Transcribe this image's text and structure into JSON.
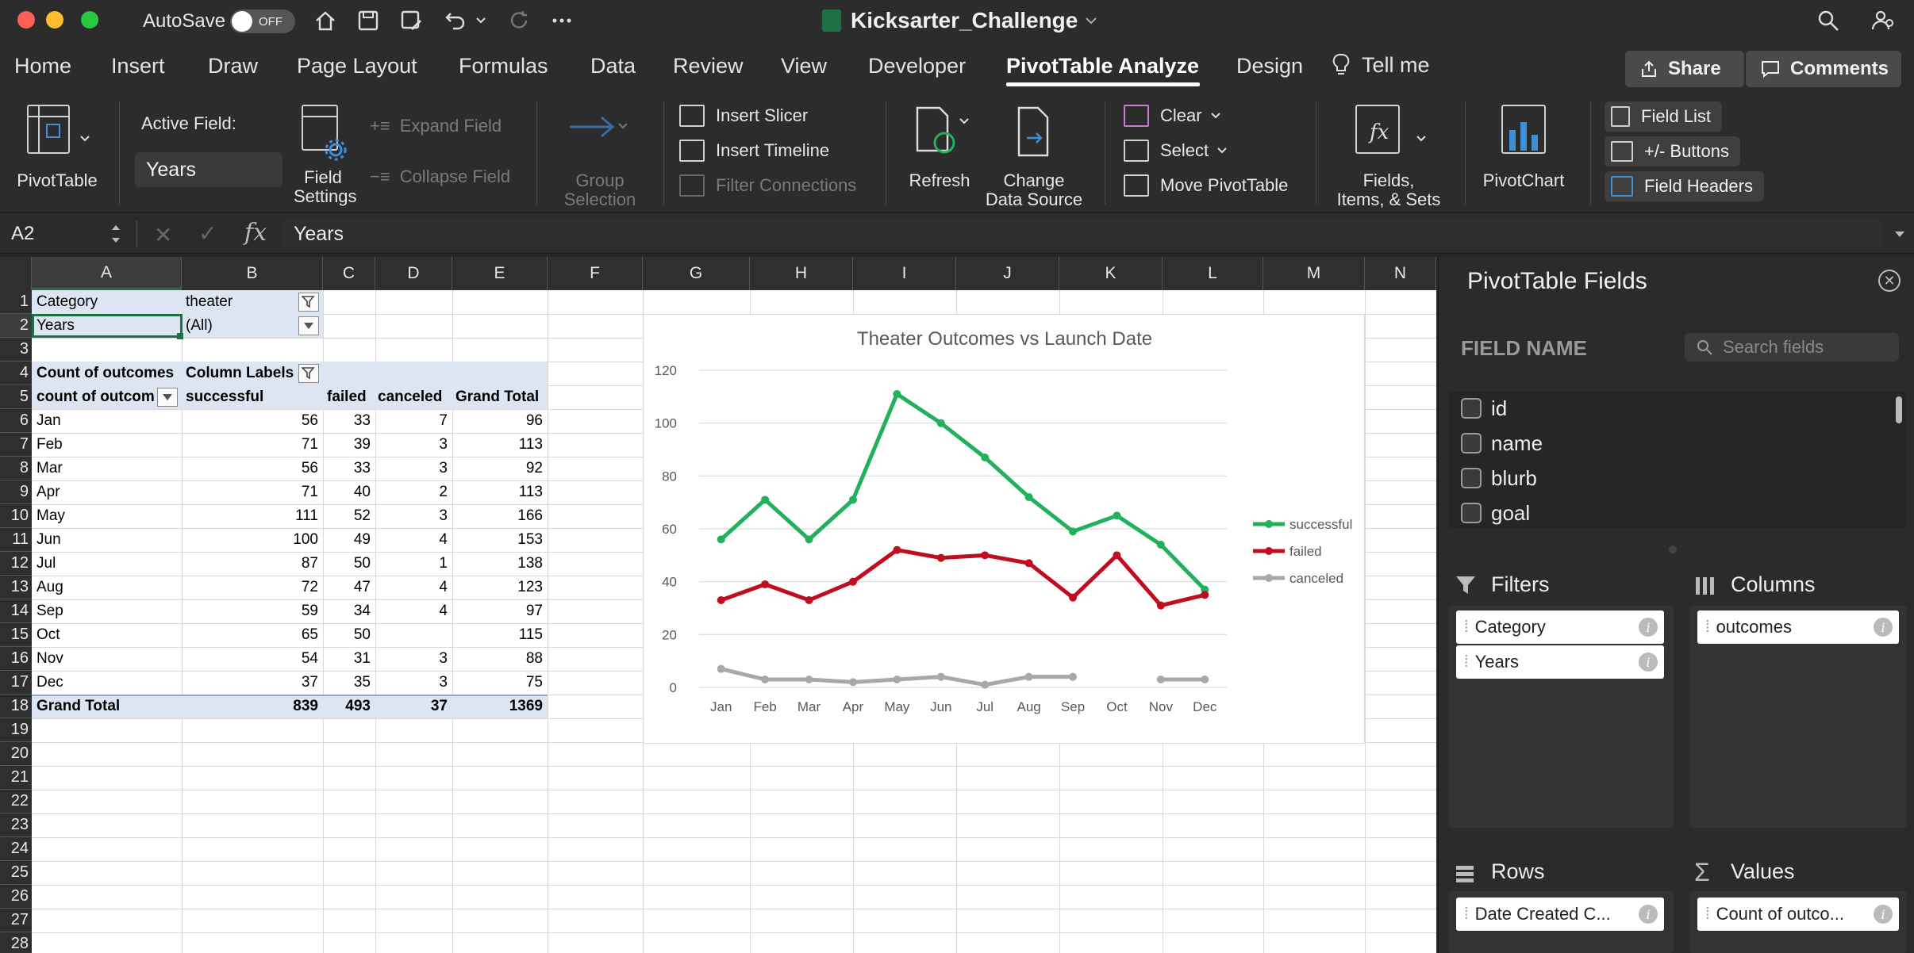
{
  "titlebar": {
    "autosave_label": "AutoSave",
    "autosave_state": "OFF",
    "document_title": "Kicksarter_Challenge",
    "icons": [
      "home-icon",
      "save-icon",
      "save-as-icon",
      "undo-icon",
      "redo-icon",
      "more-icon",
      "search-icon",
      "account-icon"
    ]
  },
  "menu": {
    "tabs": [
      "Home",
      "Insert",
      "Draw",
      "Page Layout",
      "Formulas",
      "Data",
      "Review",
      "View",
      "Developer",
      "PivotTable Analyze",
      "Design"
    ],
    "active_tab": "PivotTable Analyze",
    "tell_me": "Tell me",
    "share": "Share",
    "comments": "Comments"
  },
  "ribbon": {
    "pivottable": "PivotTable",
    "active_field_label": "Active Field:",
    "active_field_value": "Years",
    "field_settings": [
      "Field",
      "Settings"
    ],
    "expand_field": "Expand Field",
    "collapse_field": "Collapse Field",
    "group_selection": [
      "Group",
      "Selection"
    ],
    "insert_slicer": "Insert Slicer",
    "insert_timeline": "Insert Timeline",
    "filter_connections": "Filter Connections",
    "refresh": "Refresh",
    "change_data_source": [
      "Change",
      "Data Source"
    ],
    "clear": "Clear",
    "select": "Select",
    "move_pivottable": "Move PivotTable",
    "fields_items_sets": [
      "Fields,",
      "Items, & Sets"
    ],
    "pivotchart": "PivotChart",
    "field_list": "Field List",
    "plus_minus_buttons": "+/- Buttons",
    "field_headers": "Field Headers"
  },
  "formula_bar": {
    "name_box": "A2",
    "fx": "fx",
    "content": "Years"
  },
  "sheet": {
    "columns": [
      "A",
      "B",
      "C",
      "D",
      "E",
      "F",
      "G",
      "H",
      "I",
      "J",
      "K",
      "L",
      "M",
      "N"
    ],
    "rows": [
      "1",
      "2",
      "3",
      "4",
      "5",
      "6",
      "7",
      "8",
      "9",
      "10",
      "11",
      "12",
      "13",
      "14",
      "15",
      "16",
      "17",
      "18",
      "19",
      "20",
      "21",
      "22",
      "23",
      "24",
      "25",
      "26",
      "27",
      "28"
    ],
    "filter": {
      "row1": [
        "Category",
        "theater"
      ],
      "row2": [
        "Years",
        "(All)"
      ]
    },
    "pivot_header": {
      "row4": [
        "Count of outcomes",
        "Column Labels"
      ],
      "row5": [
        "count of outcom",
        "successful",
        "failed",
        "canceled",
        "Grand Total"
      ]
    },
    "pivot_rows": [
      [
        "Jan",
        "56",
        "33",
        "7",
        "96"
      ],
      [
        "Feb",
        "71",
        "39",
        "3",
        "113"
      ],
      [
        "Mar",
        "56",
        "33",
        "3",
        "92"
      ],
      [
        "Apr",
        "71",
        "40",
        "2",
        "113"
      ],
      [
        "May",
        "111",
        "52",
        "3",
        "166"
      ],
      [
        "Jun",
        "100",
        "49",
        "4",
        "153"
      ],
      [
        "Jul",
        "87",
        "50",
        "1",
        "138"
      ],
      [
        "Aug",
        "72",
        "47",
        "4",
        "123"
      ],
      [
        "Sep",
        "59",
        "34",
        "4",
        "97"
      ],
      [
        "Oct",
        "65",
        "50",
        "",
        "115"
      ],
      [
        "Nov",
        "54",
        "31",
        "3",
        "88"
      ],
      [
        "Dec",
        "37",
        "35",
        "3",
        "75"
      ]
    ],
    "grand_total": [
      "Grand Total",
      "839",
      "493",
      "37",
      "1369"
    ]
  },
  "chart_data": {
    "type": "line",
    "title": "Theater Outcomes vs Launch Date",
    "categories": [
      "Jan",
      "Feb",
      "Mar",
      "Apr",
      "May",
      "Jun",
      "Jul",
      "Aug",
      "Sep",
      "Oct",
      "Nov",
      "Dec"
    ],
    "series": [
      {
        "name": "successful",
        "color": "#22b05a",
        "values": [
          56,
          71,
          56,
          71,
          111,
          100,
          87,
          72,
          59,
          65,
          54,
          37
        ]
      },
      {
        "name": "failed",
        "color": "#c00d1f",
        "values": [
          33,
          39,
          33,
          40,
          52,
          49,
          50,
          47,
          34,
          50,
          31,
          35
        ]
      },
      {
        "name": "canceled",
        "color": "#a8a8a8",
        "values": [
          7,
          3,
          3,
          2,
          3,
          4,
          1,
          4,
          4,
          null,
          3,
          3
        ]
      }
    ],
    "ylim": [
      0,
      120
    ],
    "yticks": [
      "0",
      "20",
      "40",
      "60",
      "80",
      "100",
      "120"
    ],
    "grid": true,
    "legend_position": "right"
  },
  "pane": {
    "title": "PivotTable Fields",
    "field_name_label": "FIELD NAME",
    "search_placeholder": "Search fields",
    "fields": [
      "id",
      "name",
      "blurb",
      "goal"
    ],
    "filters_label": "Filters",
    "columns_label": "Columns",
    "rows_label": "Rows",
    "values_label": "Values",
    "filters": [
      "Category",
      "Years"
    ],
    "columns": [
      "outcomes"
    ],
    "rows": [
      "Date Created C..."
    ],
    "values": [
      "Count of outco..."
    ]
  },
  "colors": {
    "accent_green": "#22b05a",
    "pivot_header_blue": "#dde4f2",
    "excel_green": "#1e7145"
  }
}
